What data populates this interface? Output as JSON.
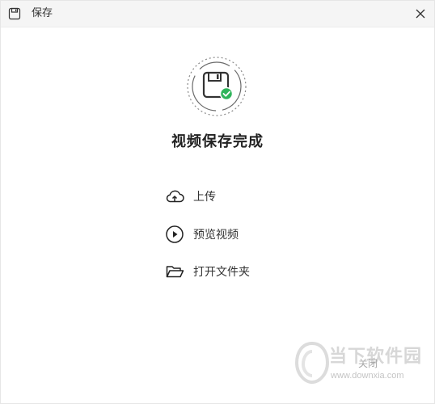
{
  "window": {
    "title": "保存"
  },
  "main": {
    "heading": "视频保存完成",
    "actions": [
      {
        "label": "上传",
        "icon": "cloud-upload-icon"
      },
      {
        "label": "预览视频",
        "icon": "play-circle-icon"
      },
      {
        "label": "打开文件夹",
        "icon": "folder-open-icon"
      }
    ]
  },
  "watermark": {
    "brand": "当下软件园",
    "url": "www.downxia.com",
    "overlay": "关闭"
  },
  "colors": {
    "success": "#2fb45a",
    "titlebar": "#f5f5f5"
  }
}
